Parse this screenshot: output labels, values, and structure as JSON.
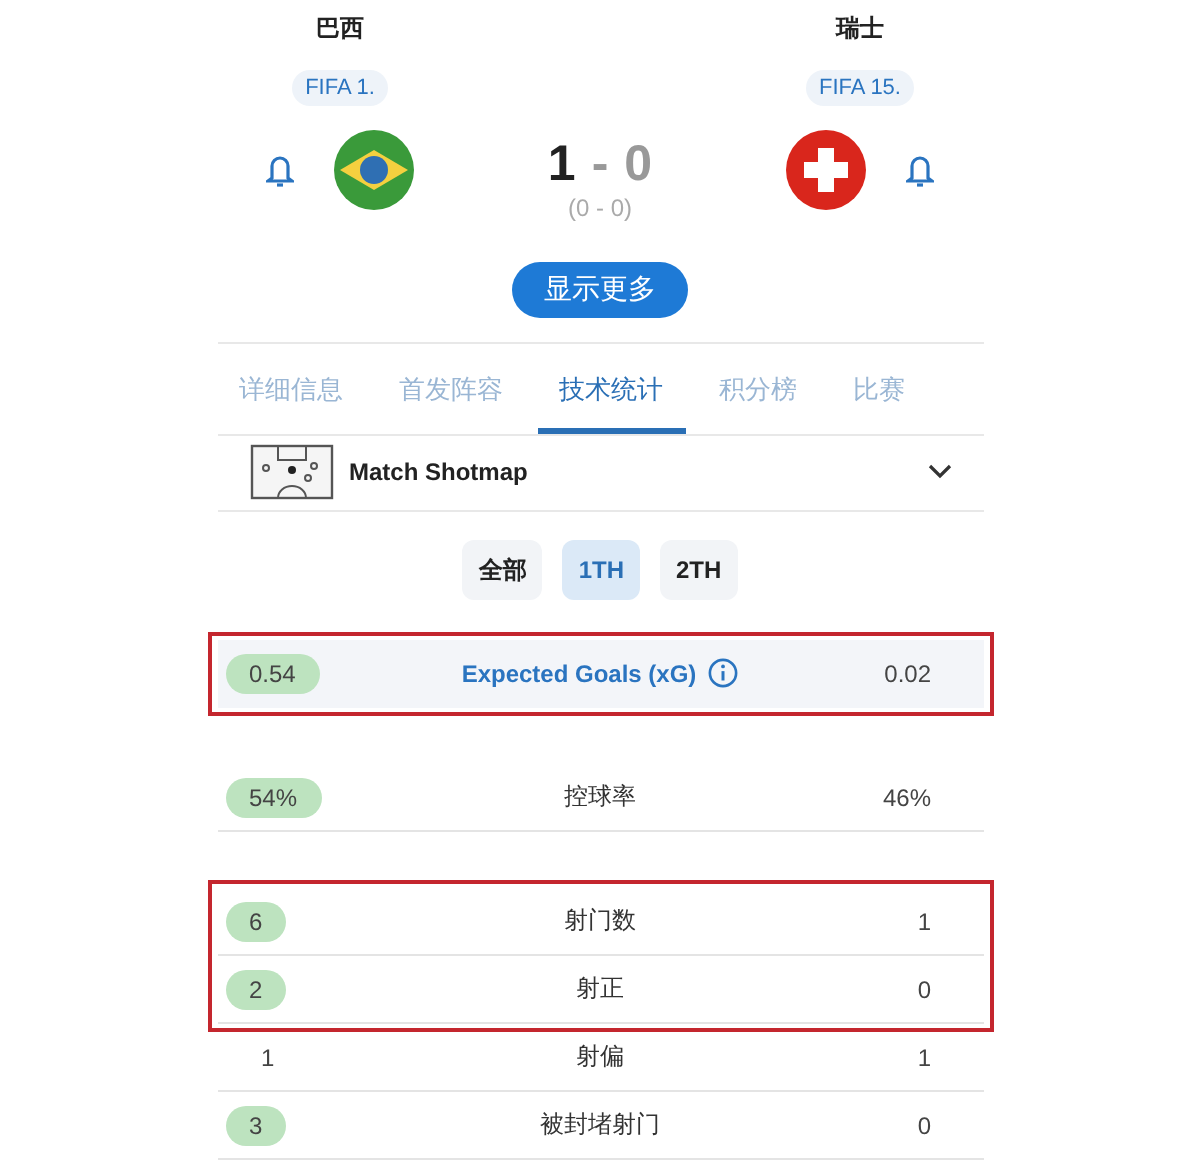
{
  "home": {
    "name": "巴西",
    "rank": "FIFA 1.",
    "flag": {
      "kind": "brazil"
    }
  },
  "away": {
    "name": "瑞士",
    "rank": "FIFA 15.",
    "flag": {
      "kind": "switzerland"
    }
  },
  "score": {
    "home": "1",
    "separator": "-",
    "away": "0",
    "halftime": "(0 - 0)"
  },
  "more_button": "显示更多",
  "tabs": [
    {
      "label": "详细信息",
      "selected": false
    },
    {
      "label": "首发阵容",
      "selected": false
    },
    {
      "label": "技术统计",
      "selected": true
    },
    {
      "label": "积分榜",
      "selected": false
    },
    {
      "label": "比赛",
      "selected": false
    }
  ],
  "shotmap": {
    "title": "Match Shotmap",
    "expanded": false
  },
  "periods": [
    {
      "label": "全部",
      "selected": false
    },
    {
      "label": "1TH",
      "selected": true
    },
    {
      "label": "2TH",
      "selected": false
    }
  ],
  "stat_sections": [
    {
      "rows": [
        {
          "kind": "xg",
          "highlighted": true,
          "label": "Expected Goals (xG)",
          "home": "0.54",
          "home_leading": true,
          "away": "0.02",
          "away_leading": false
        }
      ]
    },
    {
      "rows": [
        {
          "kind": "plain",
          "highlighted": false,
          "label": "控球率",
          "home": "54%",
          "home_leading": true,
          "away": "46%",
          "away_leading": false
        }
      ]
    },
    {
      "rows": [
        {
          "kind": "plain",
          "highlighted": true,
          "label": "射门数",
          "home": "6",
          "home_leading": true,
          "away": "1",
          "away_leading": false
        },
        {
          "kind": "plain",
          "highlighted": true,
          "label": "射正",
          "home": "2",
          "home_leading": true,
          "away": "0",
          "away_leading": false
        },
        {
          "kind": "plain",
          "highlighted": false,
          "label": "射偏",
          "home": "1",
          "home_leading": false,
          "away": "1",
          "away_leading": false
        },
        {
          "kind": "plain",
          "highlighted": false,
          "label": "被封堵射门",
          "home": "3",
          "home_leading": true,
          "away": "0",
          "away_leading": false
        }
      ]
    }
  ]
}
